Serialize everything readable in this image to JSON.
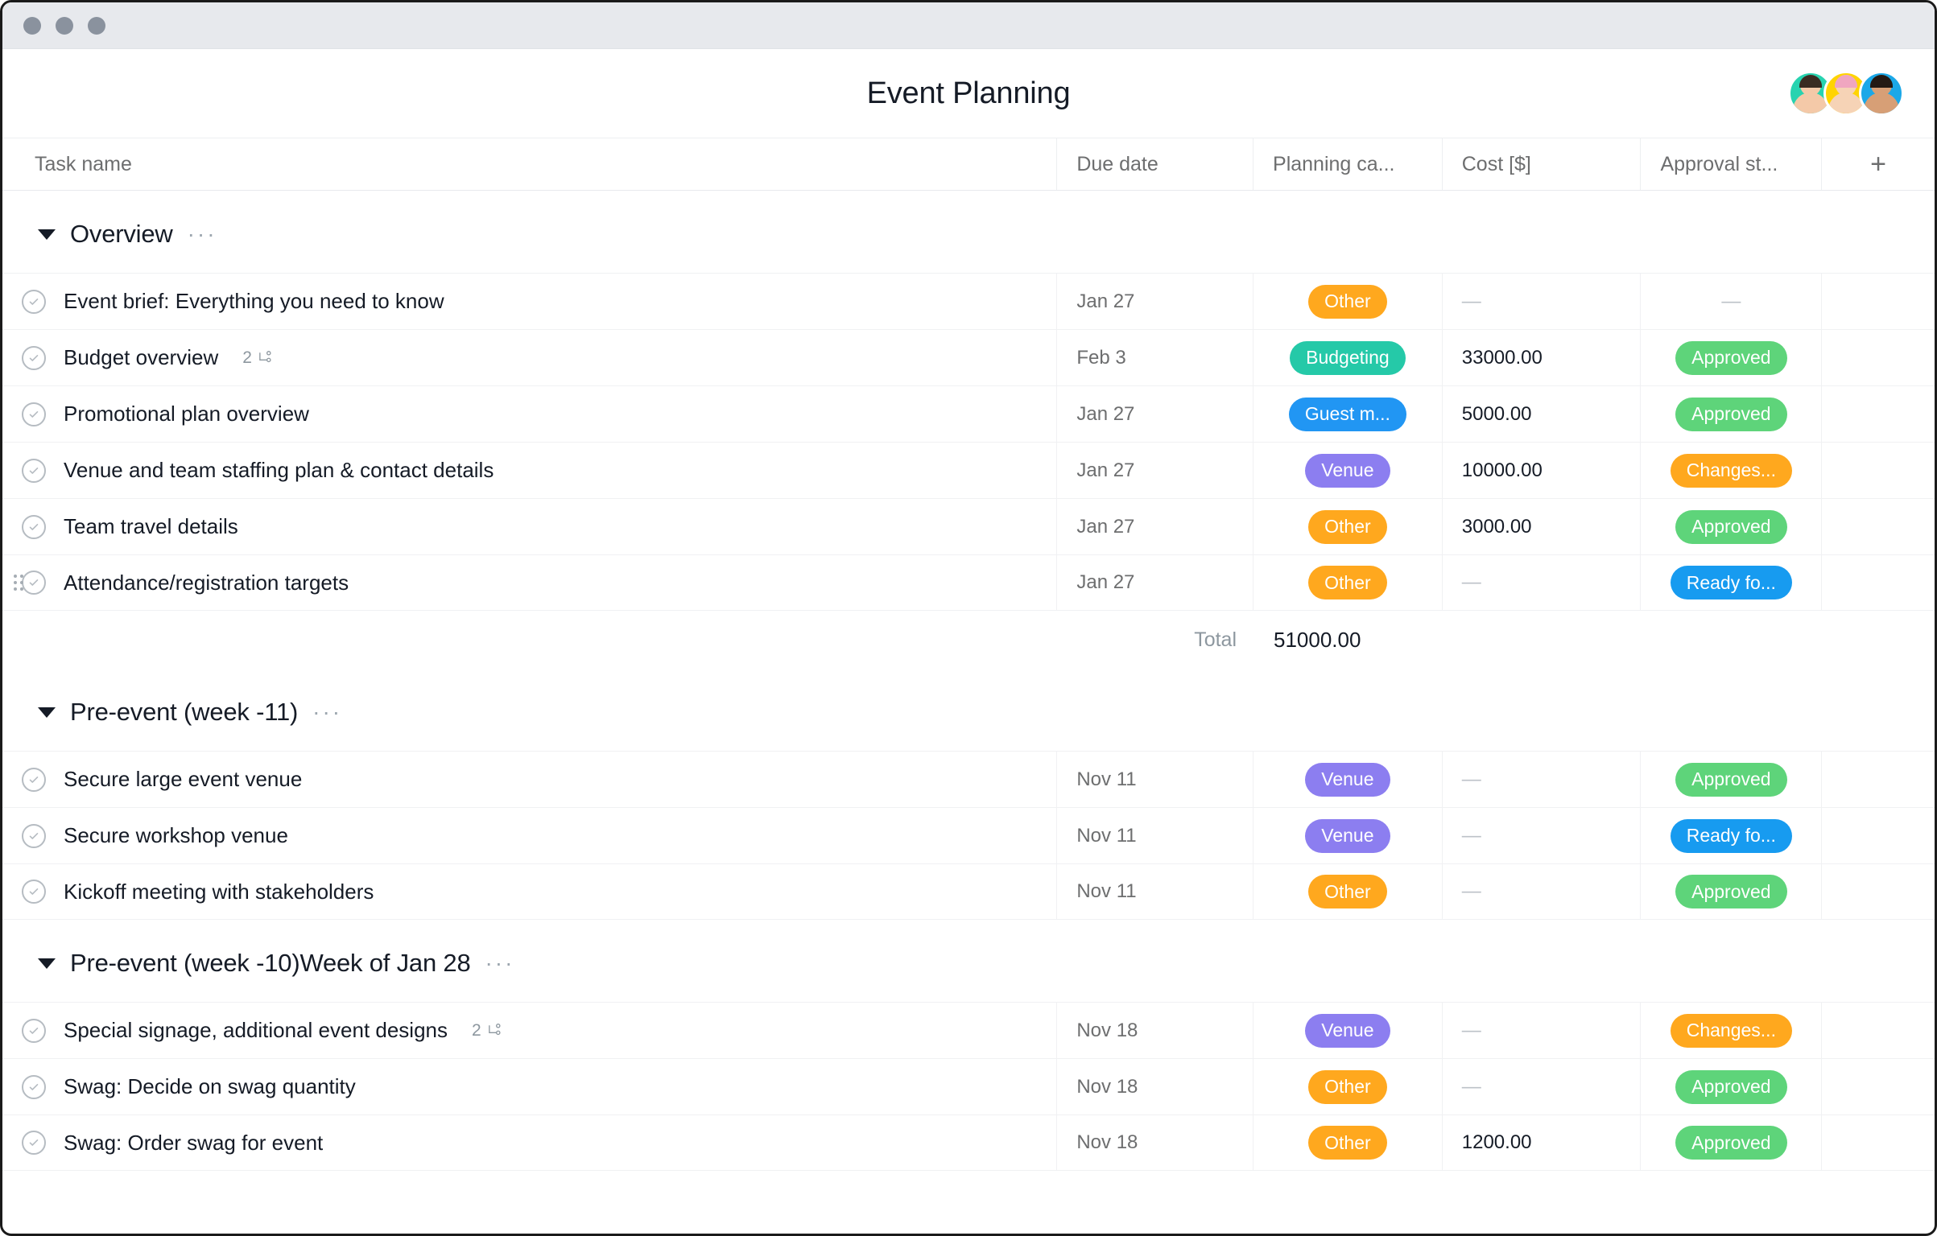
{
  "window": {
    "traffic_dots": [
      "close",
      "minimize",
      "maximize"
    ]
  },
  "header": {
    "title": "Event Planning",
    "avatars": [
      {
        "name": "avatar-1",
        "bg": "#27d3b0",
        "skin": "#f4c9a8",
        "hair": "#3a2c22"
      },
      {
        "name": "avatar-2",
        "bg": "#ffd400",
        "skin": "#f6d3b6",
        "hair": "#f0a6c0"
      },
      {
        "name": "avatar-3",
        "bg": "#1ba8e8",
        "skin": "#d79f76",
        "hair": "#241a14"
      }
    ]
  },
  "columns": {
    "task": "Task name",
    "due": "Due date",
    "category": "Planning ca...",
    "cost": "Cost [$]",
    "approval": "Approval st...",
    "add": "+"
  },
  "pill_colors": {
    "Other": "#ffa81e",
    "Budgeting": "#25c9a8",
    "Guest m...": "#2196f3",
    "Venue": "#8c7ef0",
    "Approved": "#5ed47a",
    "Changes...": "#ffa81e",
    "Ready fo...": "#179bf0"
  },
  "sections": [
    {
      "title": "Overview",
      "menu": "···",
      "rows": [
        {
          "task": "Event brief: Everything you need to know",
          "subtasks": "",
          "due": "Jan 27",
          "category": "Other",
          "cost": "—",
          "approval": "—",
          "approval_is_pill": false,
          "cost_is_dash": true,
          "drag": false
        },
        {
          "task": "Budget overview",
          "subtasks": "2",
          "due": "Feb 3",
          "category": "Budgeting",
          "cost": "33000.00",
          "approval": "Approved",
          "approval_is_pill": true,
          "cost_is_dash": false,
          "drag": false
        },
        {
          "task": "Promotional plan overview",
          "subtasks": "",
          "due": "Jan 27",
          "category": "Guest m...",
          "cost": "5000.00",
          "approval": "Approved",
          "approval_is_pill": true,
          "cost_is_dash": false,
          "drag": false
        },
        {
          "task": "Venue and team staffing plan & contact details",
          "subtasks": "",
          "due": "Jan 27",
          "category": "Venue",
          "cost": "10000.00",
          "approval": "Changes...",
          "approval_is_pill": true,
          "cost_is_dash": false,
          "drag": false
        },
        {
          "task": "Team travel details",
          "subtasks": "",
          "due": "Jan 27",
          "category": "Other",
          "cost": "3000.00",
          "approval": "Approved",
          "approval_is_pill": true,
          "cost_is_dash": false,
          "drag": false
        },
        {
          "task": "Attendance/registration targets",
          "subtasks": "",
          "due": "Jan 27",
          "category": "Other",
          "cost": "—",
          "approval": "Ready fo...",
          "approval_is_pill": true,
          "cost_is_dash": true,
          "drag": true
        }
      ],
      "total": {
        "label": "Total",
        "value": "51000.00"
      }
    },
    {
      "title": "Pre-event (week -11)",
      "menu": "···",
      "rows": [
        {
          "task": "Secure large event venue",
          "subtasks": "",
          "due": "Nov 11",
          "category": "Venue",
          "cost": "—",
          "approval": "Approved",
          "approval_is_pill": true,
          "cost_is_dash": true,
          "drag": false
        },
        {
          "task": "Secure workshop venue",
          "subtasks": "",
          "due": "Nov 11",
          "category": "Venue",
          "cost": "—",
          "approval": "Ready fo...",
          "approval_is_pill": true,
          "cost_is_dash": true,
          "drag": false
        },
        {
          "task": "Kickoff meeting with stakeholders",
          "subtasks": "",
          "due": "Nov 11",
          "category": "Other",
          "cost": "—",
          "approval": "Approved",
          "approval_is_pill": true,
          "cost_is_dash": true,
          "drag": false
        }
      ],
      "total": null
    },
    {
      "title": "Pre-event (week -10)Week of Jan 28",
      "menu": "···",
      "rows": [
        {
          "task": "Special signage, additional event designs",
          "subtasks": "2",
          "due": "Nov 18",
          "category": "Venue",
          "cost": "—",
          "approval": "Changes...",
          "approval_is_pill": true,
          "cost_is_dash": true,
          "drag": false
        },
        {
          "task": "Swag: Decide on swag quantity",
          "subtasks": "",
          "due": "Nov 18",
          "category": "Other",
          "cost": "—",
          "approval": "Approved",
          "approval_is_pill": true,
          "cost_is_dash": true,
          "drag": false
        },
        {
          "task": "Swag: Order swag for event",
          "subtasks": "",
          "due": "Nov 18",
          "category": "Other",
          "cost": "1200.00",
          "approval": "Approved",
          "approval_is_pill": true,
          "cost_is_dash": false,
          "drag": false
        }
      ],
      "total": null
    }
  ]
}
